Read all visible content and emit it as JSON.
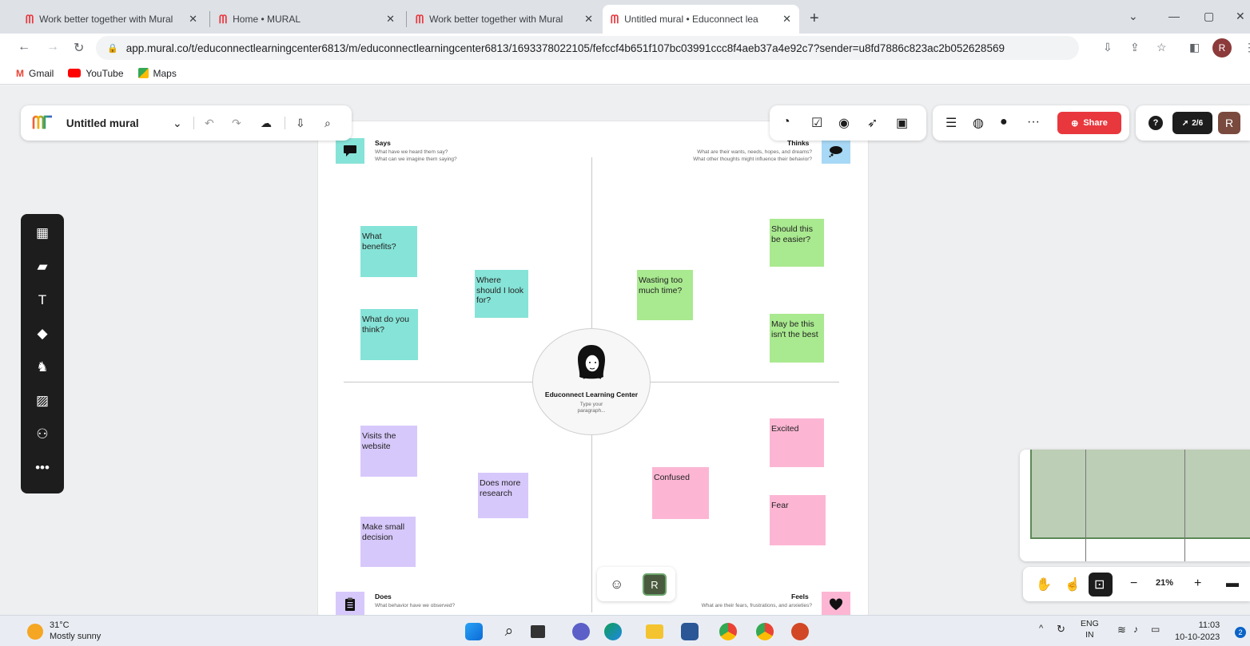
{
  "browser": {
    "tabs": [
      {
        "title": "Work better together with Mural",
        "active": false
      },
      {
        "title": "Home • MURAL",
        "active": false
      },
      {
        "title": "Work better together with Mural",
        "active": false
      },
      {
        "title": "Untitled mural • Educonnect lea",
        "active": true
      }
    ],
    "url": "app.mural.co/t/educonnectlearningcenter6813/m/educonnectlearningcenter6813/1693378022105/fefccf4b651f107bc03991ccc8f4aeb37a4e92c7?sender=u8fd7886c823ac2b052628569",
    "profile_initial": "R",
    "bookmarks": [
      {
        "label": "Gmail",
        "icon": "gmail-icon"
      },
      {
        "label": "YouTube",
        "icon": "youtube-icon"
      },
      {
        "label": "Maps",
        "icon": "maps-icon"
      }
    ]
  },
  "mural": {
    "title": "Untitled mural",
    "share_label": "Share",
    "rocket_label": "2/6",
    "user_initial": "R",
    "zoom": "21%",
    "brand_color": "#e8383d"
  },
  "empathy_map": {
    "center": {
      "title": "Educonnect  Learning Center",
      "placeholder": "Type your paragraph..."
    },
    "quadrants": {
      "says": {
        "title": "Says",
        "line1": "What have we heard them say?",
        "line2": "What can we imagine them saying?"
      },
      "thinks": {
        "title": "Thinks",
        "line1": "What are their wants, needs, hopes, and dreams?",
        "line2": "What other thoughts might influence their behavior?"
      },
      "does": {
        "title": "Does",
        "line1": "What behavior have we observed?"
      },
      "feels": {
        "title": "Feels",
        "line1": "What are their fears, frustrations, and anxieties?"
      }
    },
    "stickies": {
      "s1": "What benefits?",
      "s2": "Where should I look for?",
      "s3": "What do you think?",
      "t1": "Should this be easier?",
      "t2": "Wasting too much time?",
      "t3": "May be this isn't the best",
      "d1": "Visits the website",
      "d2": "Does more research",
      "d3": "Make small decision",
      "f1": "Excited",
      "f2": "Confused",
      "f3": "Fear"
    }
  },
  "taskbar": {
    "temperature": "31°C",
    "weather": "Mostly sunny",
    "lang1": "ENG",
    "lang2": "IN",
    "time": "11:03",
    "date": "10-10-2023",
    "notifications": "2"
  }
}
